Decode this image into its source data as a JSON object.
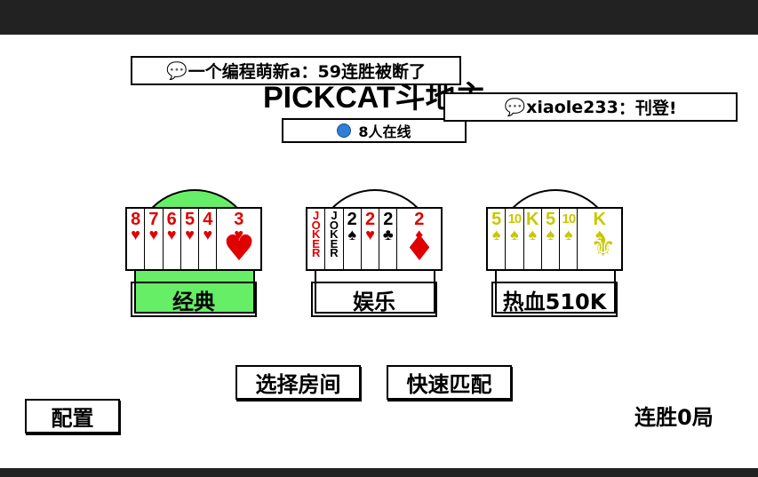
{
  "title": "PICKCAT斗地主",
  "chat": [
    {
      "icon": "💬",
      "user": "一个编程萌新a",
      "text": "59连胜被断了"
    },
    {
      "icon": "💬",
      "user": "xiaole233",
      "text": "刊登!"
    }
  ],
  "separator": "：",
  "online": {
    "label": "8人在线"
  },
  "modes": [
    {
      "label": "经典",
      "color": "#66ee66",
      "cards": [
        {
          "rank": "8",
          "suit": "♥",
          "color": "#e00000"
        },
        {
          "rank": "7",
          "suit": "♥",
          "color": "#e00000"
        },
        {
          "rank": "6",
          "suit": "♥",
          "color": "#e00000"
        },
        {
          "rank": "5",
          "suit": "♥",
          "color": "#e00000"
        },
        {
          "rank": "4",
          "suit": "♥",
          "color": "#e00000"
        },
        {
          "rank": "3",
          "suit": "♥",
          "color": "#e00000"
        }
      ],
      "big_suit": "♥",
      "big_color": "#e00000"
    },
    {
      "label": "娱乐",
      "color": "#ffffff",
      "cards": [
        {
          "rank": "JOKER",
          "suit": "",
          "color": "#e00000"
        },
        {
          "rank": "JOKER",
          "suit": "",
          "color": "#000000"
        },
        {
          "rank": "2",
          "suit": "♠",
          "color": "#000000"
        },
        {
          "rank": "2",
          "suit": "♥",
          "color": "#e00000"
        },
        {
          "rank": "2",
          "suit": "♣",
          "color": "#000000"
        },
        {
          "rank": "2",
          "suit": "♦",
          "color": "#e00000"
        }
      ],
      "big_suit": "♦",
      "big_color": "#e00000"
    },
    {
      "label": "热血510K",
      "color": "#ffffff",
      "cards": [
        {
          "rank": "5",
          "suit": "♠",
          "color": "#c8c800"
        },
        {
          "rank": "10",
          "suit": "♠",
          "color": "#c8c800"
        },
        {
          "rank": "K",
          "suit": "♠",
          "color": "#c8c800"
        },
        {
          "rank": "5",
          "suit": "♠",
          "color": "#c8c800"
        },
        {
          "rank": "10",
          "suit": "♠",
          "color": "#c8c800"
        },
        {
          "rank": "K",
          "suit": "♠",
          "color": "#c8c800"
        }
      ],
      "big_suit": "⚜",
      "big_color": "#c8c800"
    }
  ],
  "buttons": {
    "choose_room": "选择房间",
    "quick_match": "快速匹配",
    "config": "配置"
  },
  "streak": "连胜0局"
}
